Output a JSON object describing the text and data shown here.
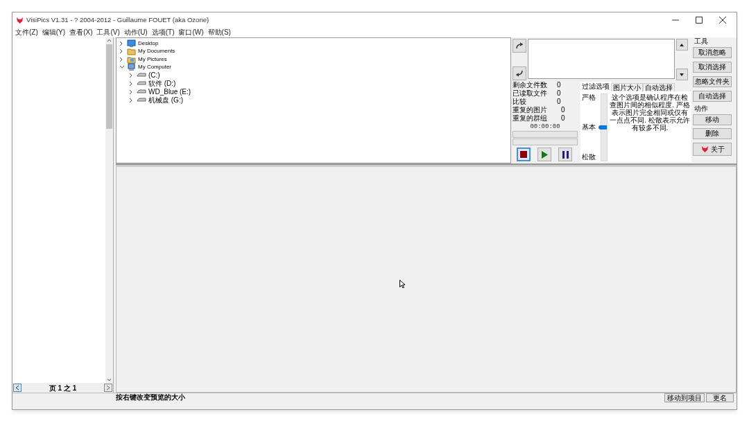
{
  "window": {
    "title": "VisiPics V1.31 - ? 2004-2012 - Guillaume FOUET (aka Ozone)"
  },
  "menu": [
    "文件(Z)",
    "编辑(Y)",
    "查看(X)",
    "工具(V)",
    "动作(U)",
    "选项(T)",
    "窗口(W)",
    "帮助(S)"
  ],
  "folder_tree": [
    {
      "label": "Desktop",
      "kind": "desktop",
      "expanded": false
    },
    {
      "label": "My Documents",
      "kind": "documents",
      "expanded": false
    },
    {
      "label": "My Pictures",
      "kind": "pictures",
      "expanded": false
    },
    {
      "label": "My Computer",
      "kind": "computer",
      "expanded": true,
      "children": [
        {
          "label": "(C:)",
          "kind": "drive",
          "expanded": false
        },
        {
          "label": "软件 (D:)",
          "kind": "drive",
          "expanded": false
        },
        {
          "label": "WD_Blue (E:)",
          "kind": "drive",
          "expanded": false
        },
        {
          "label": "机械盘 (G:)",
          "kind": "drive",
          "expanded": false
        }
      ]
    }
  ],
  "stats": [
    {
      "label": "剩余文件数",
      "value": "0"
    },
    {
      "label": "已读取文件",
      "value": "0"
    },
    {
      "label": "比较",
      "value": "0"
    },
    {
      "label": "重复的图片",
      "value": "0"
    },
    {
      "label": "重复的群组",
      "value": "0"
    }
  ],
  "timer": "00:00:00",
  "tabs": [
    {
      "label": "过滤选项",
      "selected": true
    },
    {
      "label": "图片大小",
      "selected": false
    },
    {
      "label": "自动选择",
      "selected": false
    }
  ],
  "filter": {
    "labels": [
      "严格",
      "基本",
      "松散"
    ],
    "level": 0.5,
    "description": "这个选项是确认程序在检查图片间的相似程度. 严格表示图片完全相同或仅有一点点不同. 松散表示允许有较多不同."
  },
  "tools": {
    "title": "工具",
    "buttons": [
      "取消忽略",
      "取消选择",
      "忽略文件夹",
      "自动选择"
    ]
  },
  "actions": {
    "title": "动作",
    "buttons": [
      "移动",
      "删除"
    ]
  },
  "about": "关于",
  "pager": "页 1 之 1",
  "status": {
    "hint": "按右键改变预览的大小",
    "fields": [
      "移动到项目",
      "更名"
    ]
  }
}
